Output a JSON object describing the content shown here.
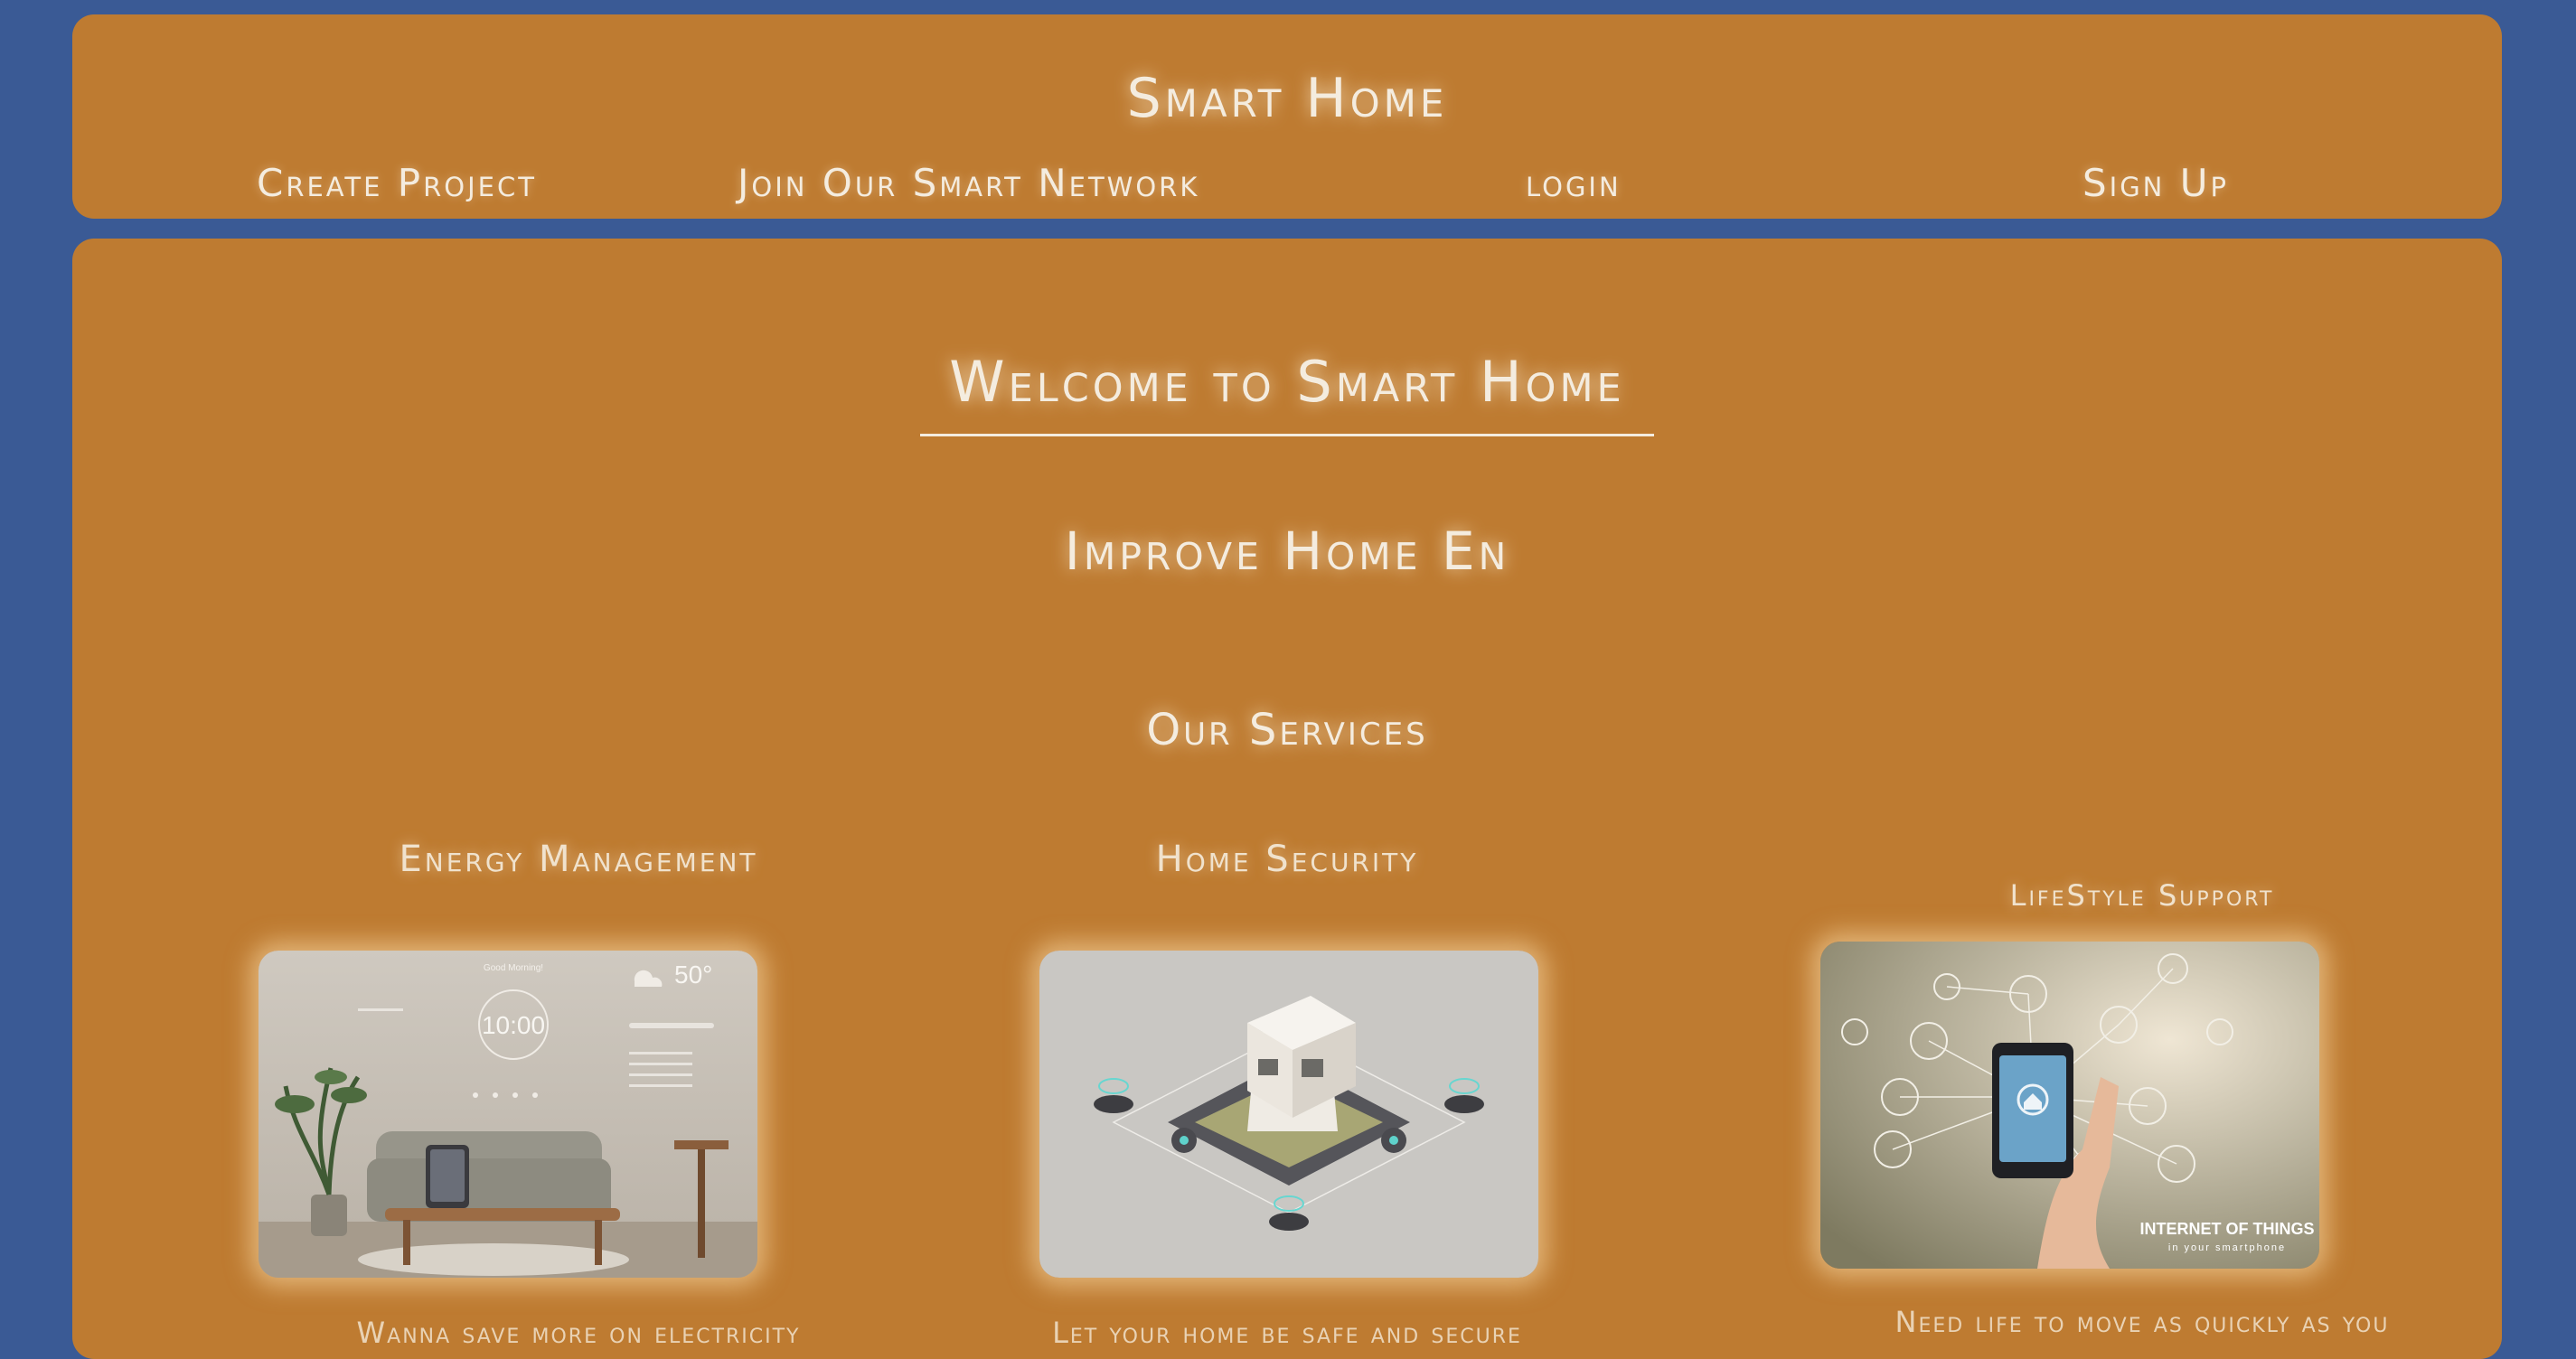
{
  "header": {
    "title": "Smart Home",
    "nav": [
      {
        "label": "Create Project"
      },
      {
        "label": "Join Our Smart Network"
      },
      {
        "label": "login"
      },
      {
        "label": "Sign Up"
      }
    ]
  },
  "main": {
    "welcome": "Welcome to Smart Home",
    "improve": "Improve Home En",
    "services_title": "Our Services",
    "services": [
      {
        "title": "Energy Management",
        "image_overlay": {
          "greeting": "Good Morning!",
          "time": "10:00",
          "temperature": "50°"
        },
        "description": "Wanna save more on electricity"
      },
      {
        "title": "Home Security",
        "description": "Let your home be safe and secure"
      },
      {
        "title": "LifeStyle Support",
        "image_overlay": {
          "heading": "INTERNET OF THINGS",
          "subheading": "in your smartphone"
        },
        "description": "Need life to move as quickly as you"
      }
    ]
  },
  "colors": {
    "background": "#3a5a95",
    "panel": "#be7b31",
    "text": "#f4ecdf"
  }
}
